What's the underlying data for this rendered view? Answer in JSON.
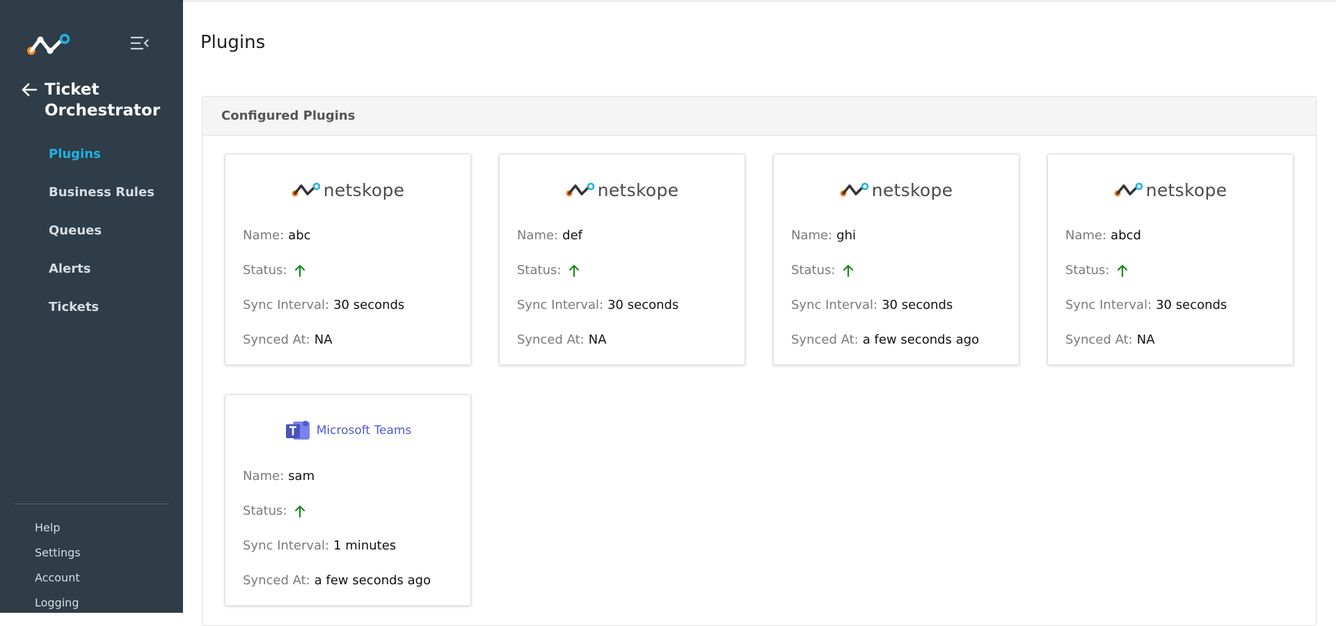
{
  "sidebar": {
    "app_title": "Ticket Orchestrator",
    "nav": [
      {
        "label": "Plugins",
        "active": true
      },
      {
        "label": "Business Rules",
        "active": false
      },
      {
        "label": "Queues",
        "active": false
      },
      {
        "label": "Alerts",
        "active": false
      },
      {
        "label": "Tickets",
        "active": false
      }
    ],
    "footer": [
      {
        "label": "Help"
      },
      {
        "label": "Settings"
      },
      {
        "label": "Account"
      },
      {
        "label": "Logging"
      }
    ]
  },
  "page": {
    "title": "Plugins",
    "panel_title": "Configured Plugins"
  },
  "labels": {
    "name": "Name:",
    "status": "Status:",
    "sync_interval": "Sync Interval:",
    "synced_at": "Synced At:"
  },
  "plugins": [
    {
      "brand": "netskope",
      "name": "abc",
      "status": "up",
      "sync_interval": "30 seconds",
      "synced_at": "NA"
    },
    {
      "brand": "netskope",
      "name": "def",
      "status": "up",
      "sync_interval": "30 seconds",
      "synced_at": "NA"
    },
    {
      "brand": "netskope",
      "name": "ghi",
      "status": "up",
      "sync_interval": "30 seconds",
      "synced_at": "a few seconds ago"
    },
    {
      "brand": "netskope",
      "name": "abcd",
      "status": "up",
      "sync_interval": "30 seconds",
      "synced_at": "NA"
    },
    {
      "brand": "Microsoft Teams",
      "name": "sam",
      "status": "up",
      "sync_interval": "1 minutes",
      "synced_at": "a few seconds ago"
    }
  ],
  "colors": {
    "sidebar_bg": "#2e3d48",
    "active_nav": "#1fb2e2",
    "status_up": "#1a8a1a",
    "netskope_orange": "#f58220",
    "netskope_blue": "#1fb2e2",
    "teams_purple": "#5059c9"
  },
  "icons": {
    "logo": "netskope-mark-icon",
    "menu_toggle": "collapse-menu-icon",
    "back": "arrow-left-icon",
    "status_up": "arrow-up-icon"
  }
}
